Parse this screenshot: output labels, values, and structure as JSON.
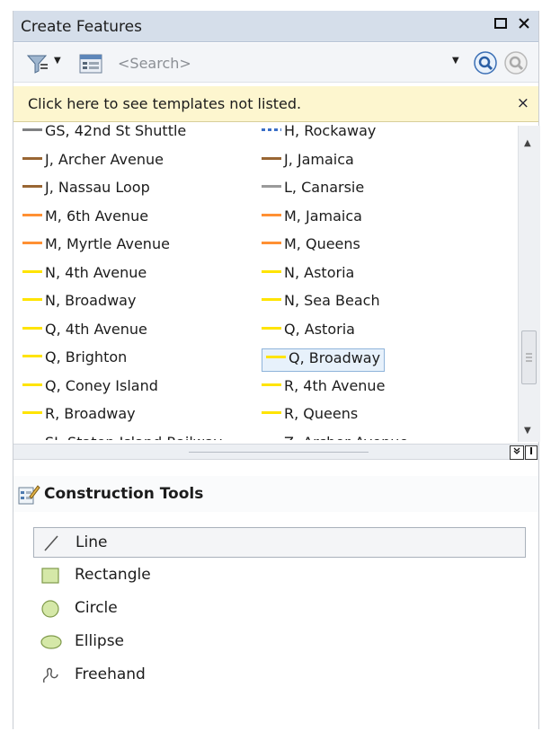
{
  "window": {
    "title": "Create Features",
    "maximize_icon": "maximize-icon",
    "close_icon": "close-icon"
  },
  "toolbar": {
    "search_placeholder": "<Search>"
  },
  "notice": {
    "text": "Click here to see templates not listed.",
    "close": "×"
  },
  "templates": {
    "left": [
      {
        "label": "GS, 42nd St Shuttle",
        "color": "#808183",
        "dashed": false
      },
      {
        "label": "J, Archer Avenue",
        "color": "#996633",
        "dashed": false
      },
      {
        "label": "J, Nassau Loop",
        "color": "#996633",
        "dashed": false
      },
      {
        "label": "M, 6th Avenue",
        "color": "#ff9033",
        "dashed": false
      },
      {
        "label": "M, Myrtle Avenue",
        "color": "#ff9033",
        "dashed": false
      },
      {
        "label": "N, 4th Avenue",
        "color": "#ffe400",
        "dashed": false
      },
      {
        "label": "N, Broadway",
        "color": "#ffe400",
        "dashed": false
      },
      {
        "label": "Q, 4th Avenue",
        "color": "#ffe400",
        "dashed": false
      },
      {
        "label": "Q, Brighton",
        "color": "#ffe400",
        "dashed": false
      },
      {
        "label": "Q, Coney Island",
        "color": "#ffe400",
        "dashed": false
      },
      {
        "label": "R, Broadway",
        "color": "#ffe400",
        "dashed": false
      },
      {
        "label": "SI, Staten Island Railway",
        "color": "#4f9ed8",
        "dashed": false
      }
    ],
    "right": [
      {
        "label": "H, Rockaway",
        "color": "#3a6fc7",
        "dashed": true
      },
      {
        "label": "J, Jamaica",
        "color": "#996633",
        "dashed": false
      },
      {
        "label": "L, Canarsie",
        "color": "#9a9a9a",
        "dashed": false
      },
      {
        "label": "M, Jamaica",
        "color": "#ff9033",
        "dashed": false
      },
      {
        "label": "M, Queens",
        "color": "#ff9033",
        "dashed": false
      },
      {
        "label": "N, Astoria",
        "color": "#ffe400",
        "dashed": false
      },
      {
        "label": "N, Sea Beach",
        "color": "#ffe400",
        "dashed": false
      },
      {
        "label": "Q, Astoria",
        "color": "#ffe400",
        "dashed": false
      },
      {
        "label": "Q, Broadway",
        "color": "#ffe400",
        "dashed": false
      },
      {
        "label": "R, 4th Avenue",
        "color": "#ffe400",
        "dashed": false
      },
      {
        "label": "R, Queens",
        "color": "#ffe400",
        "dashed": false
      },
      {
        "label": "Z, Archer Avenue",
        "color": "#996633",
        "dashed": false
      }
    ],
    "selected": "Q, Broadway"
  },
  "construction_tools": {
    "title": "Construction Tools",
    "tools": [
      {
        "label": "Line",
        "icon": "line-icon",
        "selected": true
      },
      {
        "label": "Rectangle",
        "icon": "rectangle-icon",
        "selected": false
      },
      {
        "label": "Circle",
        "icon": "circle-icon",
        "selected": false
      },
      {
        "label": "Ellipse",
        "icon": "ellipse-icon",
        "selected": false
      },
      {
        "label": "Freehand",
        "icon": "freehand-icon",
        "selected": false
      }
    ]
  },
  "colors": {
    "titlebar": "#d5deea",
    "notice": "#fdf6cf",
    "selection": "#e7f1fb",
    "shape_fill": "#d5e8a8",
    "shape_stroke": "#7f9a4a"
  }
}
